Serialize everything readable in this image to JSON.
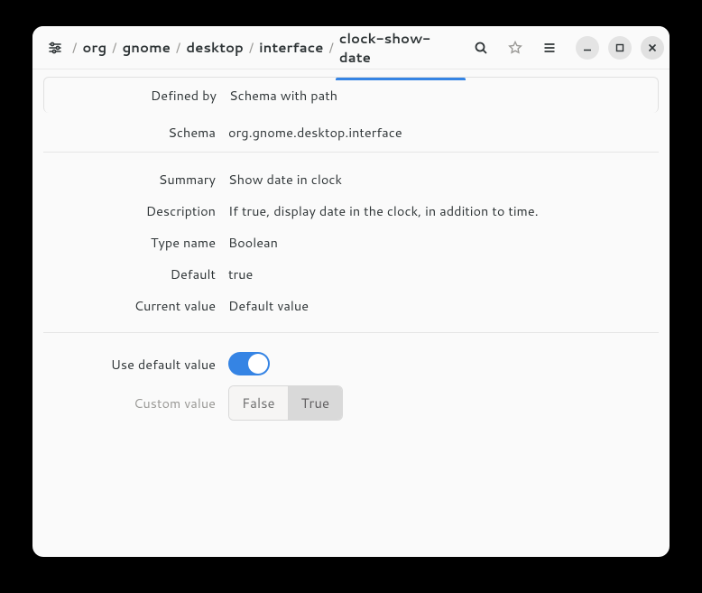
{
  "breadcrumbs": [
    "org",
    "gnome",
    "desktop",
    "interface",
    "clock-show-date"
  ],
  "breadcrumbActiveIndex": 4,
  "fields": {
    "defined_by": {
      "label": "Defined by",
      "value": "Schema with path"
    },
    "schema": {
      "label": "Schema",
      "value": "org.gnome.desktop.interface"
    },
    "summary": {
      "label": "Summary",
      "value": "Show date in clock"
    },
    "description": {
      "label": "Description",
      "value": "If true, display date in the clock, in addition to time."
    },
    "type_name": {
      "label": "Type name",
      "value": "Boolean"
    },
    "default": {
      "label": "Default",
      "value": "true"
    },
    "current": {
      "label": "Current value",
      "value": "Default value"
    },
    "use_default": {
      "label": "Use default value"
    },
    "custom": {
      "label": "Custom value",
      "options": {
        "false_label": "False",
        "true_label": "True",
        "selected": "true"
      }
    },
    "use_default_on": true
  }
}
